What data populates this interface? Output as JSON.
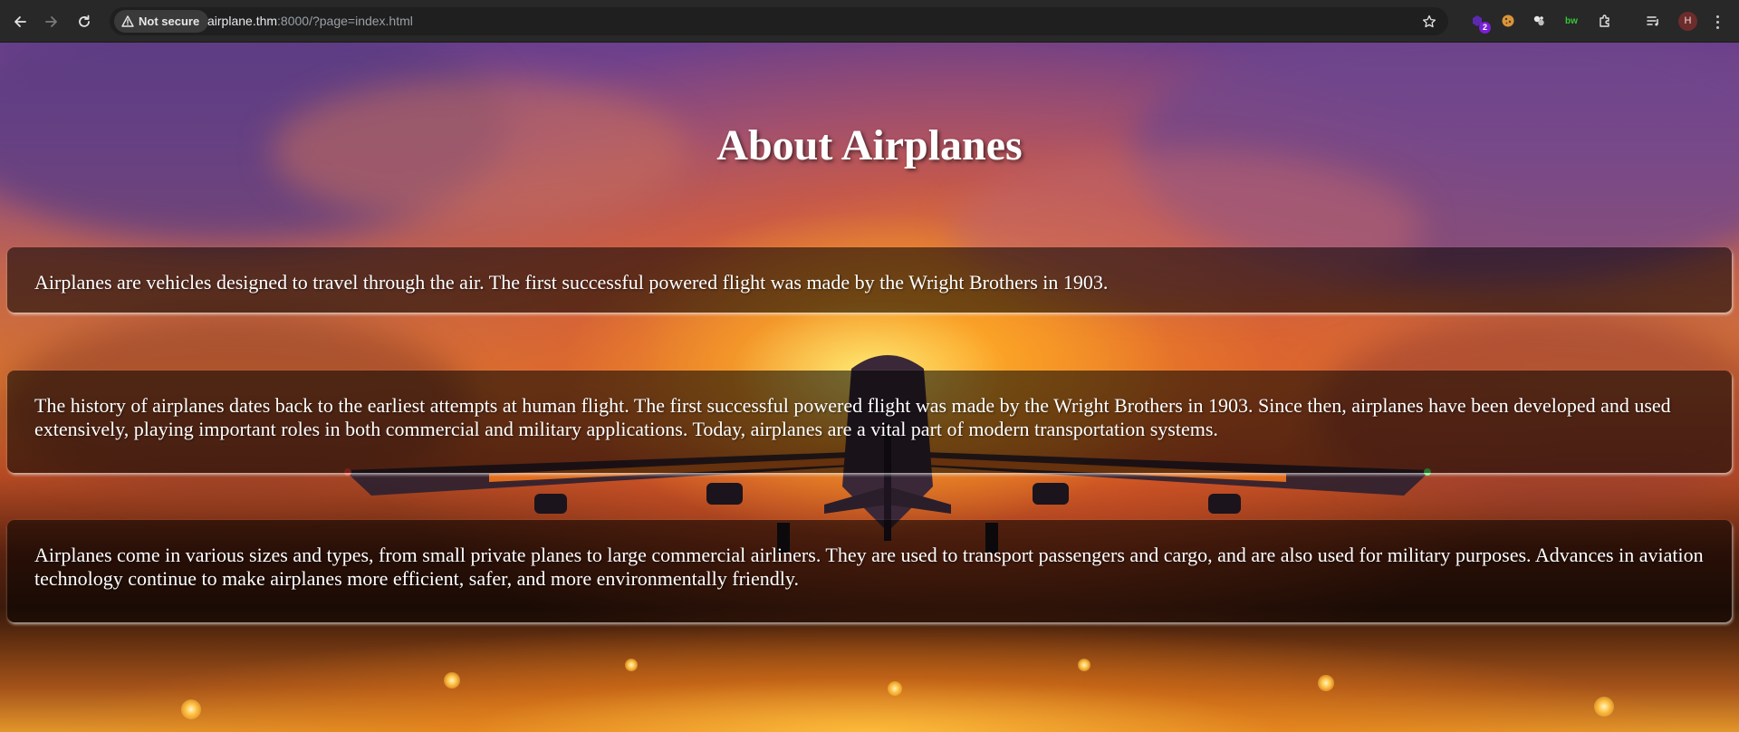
{
  "browser": {
    "security_label": "Not secure",
    "url_host": "airplane.thm",
    "url_rest": ":8000/?page=index.html",
    "extensions": [
      {
        "name": "purple-extension-icon",
        "badge": "2",
        "color": "#7a1fd8"
      },
      {
        "name": "cookie-extension-icon",
        "color": "#e0a040"
      },
      {
        "name": "dots-extension-icon",
        "color": "#e8e8e8"
      },
      {
        "name": "bitwarden-extension-icon",
        "label": "bw",
        "color": "#37c837"
      }
    ],
    "avatar_initial": "H"
  },
  "page": {
    "title": "About Airplanes",
    "sections": [
      {
        "text": "Airplanes are vehicles designed to travel through the air. The first successful powered flight was made by the Wright Brothers in 1903."
      },
      {
        "text": "The history of airplanes dates back to the earliest attempts at human flight. The first successful powered flight was made by the Wright Brothers in 1903. Since then, airplanes have been developed and used extensively, playing important roles in both commercial and military applications. Today, airplanes are a vital part of modern transportation systems."
      },
      {
        "text": "Airplanes come in various sizes and types, from small private planes to large commercial airliners. They are used to transport passengers and cargo, and are also used for military purposes. Advances in aviation technology continue to make airplanes more efficient, safer, and more environmentally friendly."
      }
    ]
  }
}
